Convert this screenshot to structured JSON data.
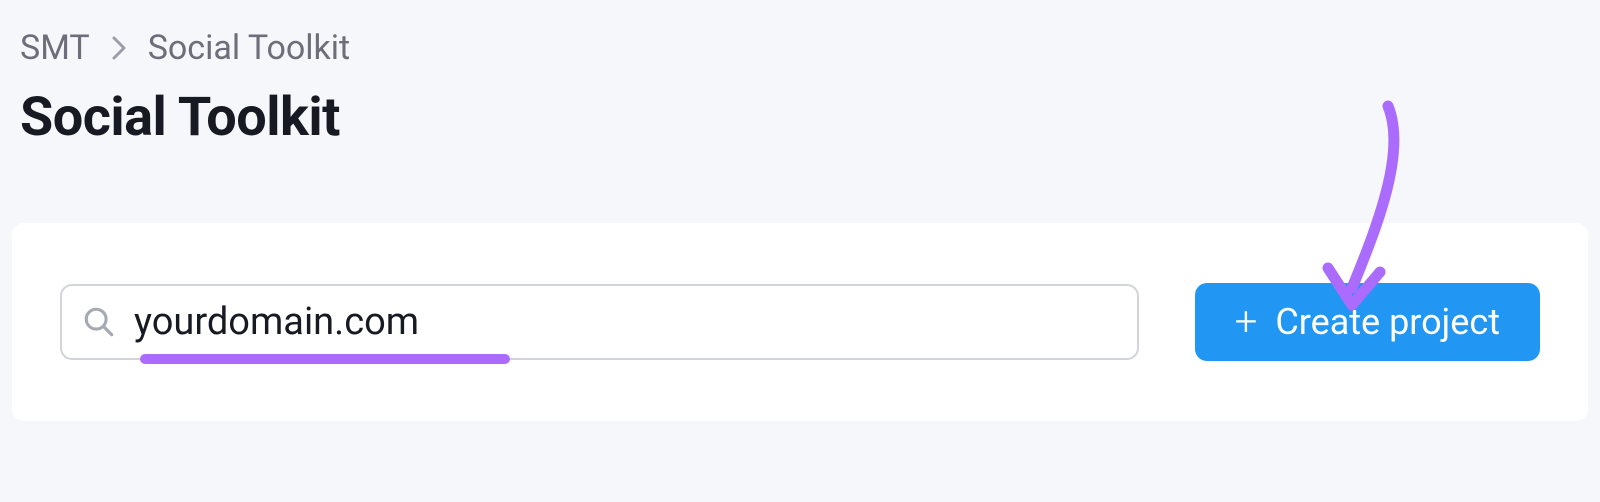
{
  "breadcrumb": {
    "items": [
      {
        "label": "SMT"
      },
      {
        "label": "Social Toolkit"
      }
    ]
  },
  "page": {
    "title": "Social Toolkit"
  },
  "search": {
    "value": "yourdomain.com",
    "placeholder": ""
  },
  "actions": {
    "create_project_label": "Create project"
  },
  "colors": {
    "accent": "#2196f3",
    "annotation": "#ab6cfd"
  }
}
